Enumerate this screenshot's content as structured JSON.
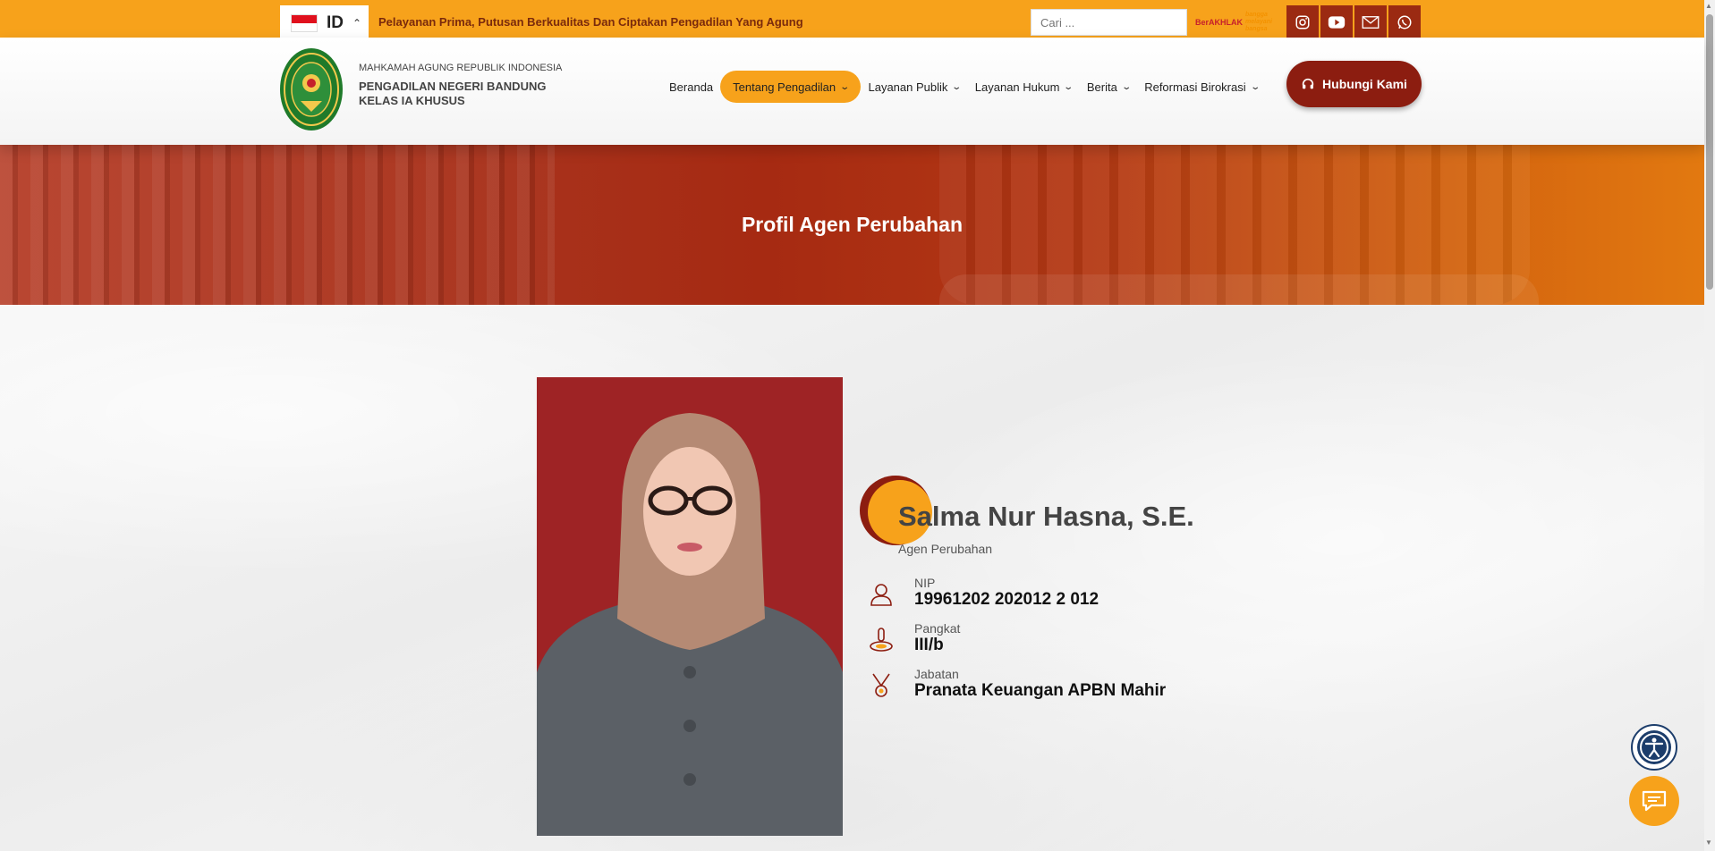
{
  "topbar": {
    "lang_code": "ID",
    "tagline": "Pelayanan Prima, Putusan Berkualitas Dan Ciptakan Pengadilan Yang Agung",
    "search_placeholder": "Cari ...",
    "berakhlak_text": "BerAKHLAK",
    "bangga_text": "bangga melayani bangsa",
    "social_icons": [
      "instagram-icon",
      "youtube-icon",
      "mail-icon",
      "whatsapp-icon"
    ],
    "accent_color": "#f7a21b",
    "social_bg_color": "#9b2a12"
  },
  "header": {
    "org_small": "MAHKAMAH AGUNG REPUBLIK INDONESIA",
    "org_line1": "PENGADILAN NEGERI BANDUNG",
    "org_line2": "KELAS IA KHUSUS",
    "nav": [
      {
        "label": "Beranda",
        "dropdown": false
      },
      {
        "label": "Tentang Pengadilan",
        "dropdown": true,
        "active": true
      },
      {
        "label": "Layanan Publik",
        "dropdown": true
      },
      {
        "label": "Layanan Hukum",
        "dropdown": true
      },
      {
        "label": "Berita",
        "dropdown": true
      },
      {
        "label": "Reformasi Birokrasi",
        "dropdown": true
      }
    ],
    "cta_label": "Hubungi Kami",
    "cta_color": "#8c1d10"
  },
  "banner": {
    "title": "Profil Agen Perubahan"
  },
  "profile": {
    "name": "Salma Nur Hasna, S.E.",
    "role": "Agen Perubahan",
    "fields": [
      {
        "label": "NIP",
        "value": "19961202 202012 2 012",
        "icon": "user-icon"
      },
      {
        "label": "Pangkat",
        "value": "III/b",
        "icon": "rank-icon"
      },
      {
        "label": "Jabatan",
        "value": "Pranata Keuangan APBN Mahir",
        "icon": "medal-icon"
      }
    ]
  }
}
